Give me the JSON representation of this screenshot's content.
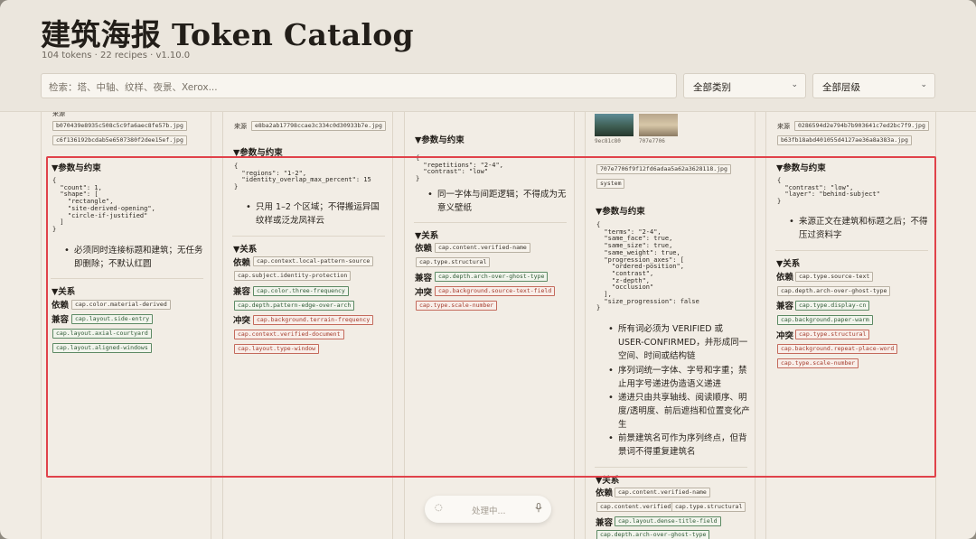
{
  "header": {
    "title": "建筑海报 Token Catalog",
    "subtitle": "104 tokens · 22 recipes · v1.10.0",
    "search_placeholder": "检索：塔、中轴、纹样、夜景、Xerox...",
    "category_select": "全部类别",
    "layer_select": "全部层级"
  },
  "labels": {
    "params": "▼参数与约束",
    "relations": "▼关系",
    "depends": "依赖",
    "compatible": "兼容",
    "conflict": "冲突",
    "source": "来源"
  },
  "col1": {
    "top_chips": [
      "b070439e8935c508c5c9fa6aec8fe57b.jpg",
      "c6f136192bcdab5e6507380f2dee15ef.jpg"
    ],
    "code": "{\n  \"count\": 1,\n  \"shape\": [\n    \"rectangle\",\n    \"site-derived-opening\",\n    \"circle-if-justified\"\n  ]\n}",
    "bullet": "必须同时连接标题和建筑；无任务即删除；不默认红圆",
    "depends": [
      "cap.color.material-derived"
    ],
    "compatible": [
      "cap.layout.side-entry",
      "cap.layout.axial-courtyard",
      "cap.layout.aligned-windows"
    ]
  },
  "col2": {
    "source_chip": "e8ba2ab17798ccae3c334c0d30933b7e.jpg",
    "code": "{\n  \"regions\": \"1-2\",\n  \"identity_overlap_max_percent\": 15\n}",
    "bullet": "只用 1–2 个区域；不得搬运异国纹样或泛龙凤祥云",
    "depends": [
      "cap.context.local-pattern-source",
      "cap.subject.identity-protection"
    ],
    "compatible": [
      "cap.color.three-frequency",
      "cap.depth.pattern-edge-over-arch"
    ],
    "conflict": [
      "cap.background.terrain-frequency",
      "cap.context.verified-document",
      "cap.layout.type-window"
    ]
  },
  "col3": {
    "code": "{\n  \"repetitions\": \"2-4\",\n  \"contrast\": \"low\"\n}",
    "bullet": "同一字体与间距逻辑；不得成为无意义壁纸",
    "depends": [
      "cap.content.verified-name",
      "cap.type.structural"
    ],
    "compatible": [
      "cap.depth.arch-over-ghost-type"
    ],
    "conflict": [
      "cap.background.source-text-field",
      "cap.type.scale-number"
    ]
  },
  "col4": {
    "thumb_captions": [
      "9ec81c80",
      "707e7706"
    ],
    "chips": [
      "707e7706f9f12fd6adaa5a62a3628118.jpg",
      "system"
    ],
    "code": "{\n  \"terms\": \"2-4\",\n  \"same_face\": true,\n  \"same_size\": true,\n  \"same_weight\": true,\n  \"progression_axes\": [\n    \"ordered-position\",\n    \"contrast\",\n    \"z-depth\",\n    \"occlusion\"\n  ],\n  \"size_progression\": false\n}",
    "bullets": [
      "所有词必须为 VERIFIED 或 USER-CONFIRMED，并形成同一空间、时间或结构链",
      "序列词统一字体、字号和字重；禁止用字号递进伪造语义递进",
      "递进只由共享轴线、阅读顺序、明度/透明度、前后遮挡和位置变化产生",
      "前景建筑名可作为序列终点，但背景词不得重复建筑名"
    ],
    "depends": [
      "cap.content.verified-name",
      "cap.content.verified-fact",
      "cap.type.structural"
    ],
    "compatible": [
      "cap.layout.dense-title-field",
      "cap.depth.arch-over-ghost-type"
    ]
  },
  "col5": {
    "top_chips": [
      "0286594d2e794b7b903641c7ed2bc7f9.jpg",
      "b63fb18abd401055d4127ae36a8a383a.jpg"
    ],
    "code": "{\n  \"contrast\": \"low\",\n  \"layer\": \"behind-subject\"\n}",
    "bullet": "来源正文在建筑和标题之后；不得压过资料字",
    "depends": [
      "cap.type.source-text",
      "cap.depth.arch-over-ghost-type"
    ],
    "compatible": [
      "cap.type.display-cn",
      "cap.background.paper-warm"
    ],
    "conflict": [
      "cap.type.structural",
      "cap.background.repeat-place-word",
      "cap.type.scale-number"
    ]
  },
  "status": {
    "processing": "处理中..."
  },
  "colors": {
    "highlight": "#e0424a",
    "compatible_chip": "#5d8a64",
    "conflict_chip": "#c46a5c"
  }
}
